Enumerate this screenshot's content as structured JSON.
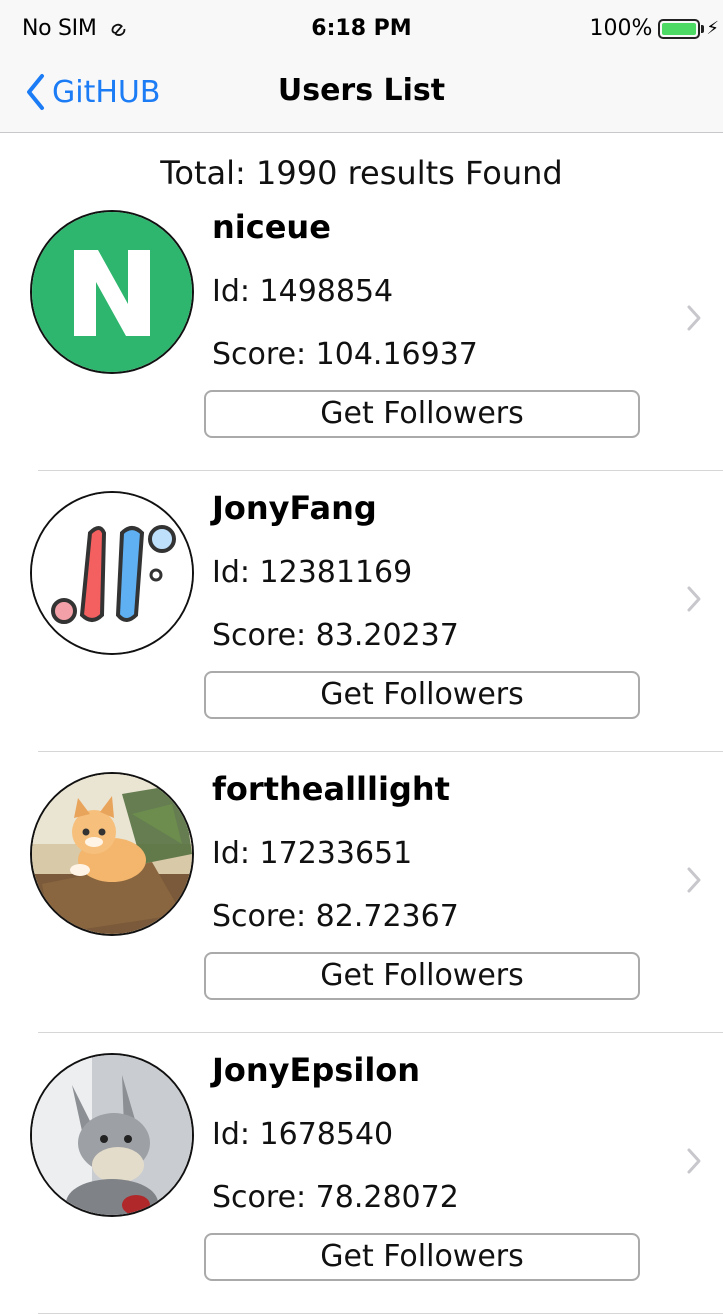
{
  "status_bar": {
    "carrier": "No SIM",
    "time": "6:18 PM",
    "battery_text": "100%",
    "battery_level": 1.0,
    "icons": [
      "wifi-icon",
      "battery-icon",
      "charging-bolt-icon"
    ]
  },
  "nav": {
    "back_label": "GitHUB",
    "title": "Users List",
    "accent_color": "#1b7cf5"
  },
  "total_label": "Total: 1990 results Found",
  "users": [
    {
      "login": "niceue",
      "id_text": "Id: 1498854",
      "score_text": "Score: 104.16937",
      "button_label": "Get Followers",
      "avatar": "green-n-logo"
    },
    {
      "login": "JonyFang",
      "id_text": "Id: 12381169",
      "score_text": "Score: 83.20237",
      "button_label": "Get Followers",
      "avatar": "jf-logo"
    },
    {
      "login": "forthealllight",
      "id_text": "Id: 17233651",
      "score_text": "Score: 82.72367",
      "button_label": "Get Followers",
      "avatar": "kitten-photo"
    },
    {
      "login": "JonyEpsilon",
      "id_text": "Id: 1678540",
      "score_text": "Score: 78.28072",
      "button_label": "Get Followers",
      "avatar": "plush-donkey-photo"
    }
  ]
}
